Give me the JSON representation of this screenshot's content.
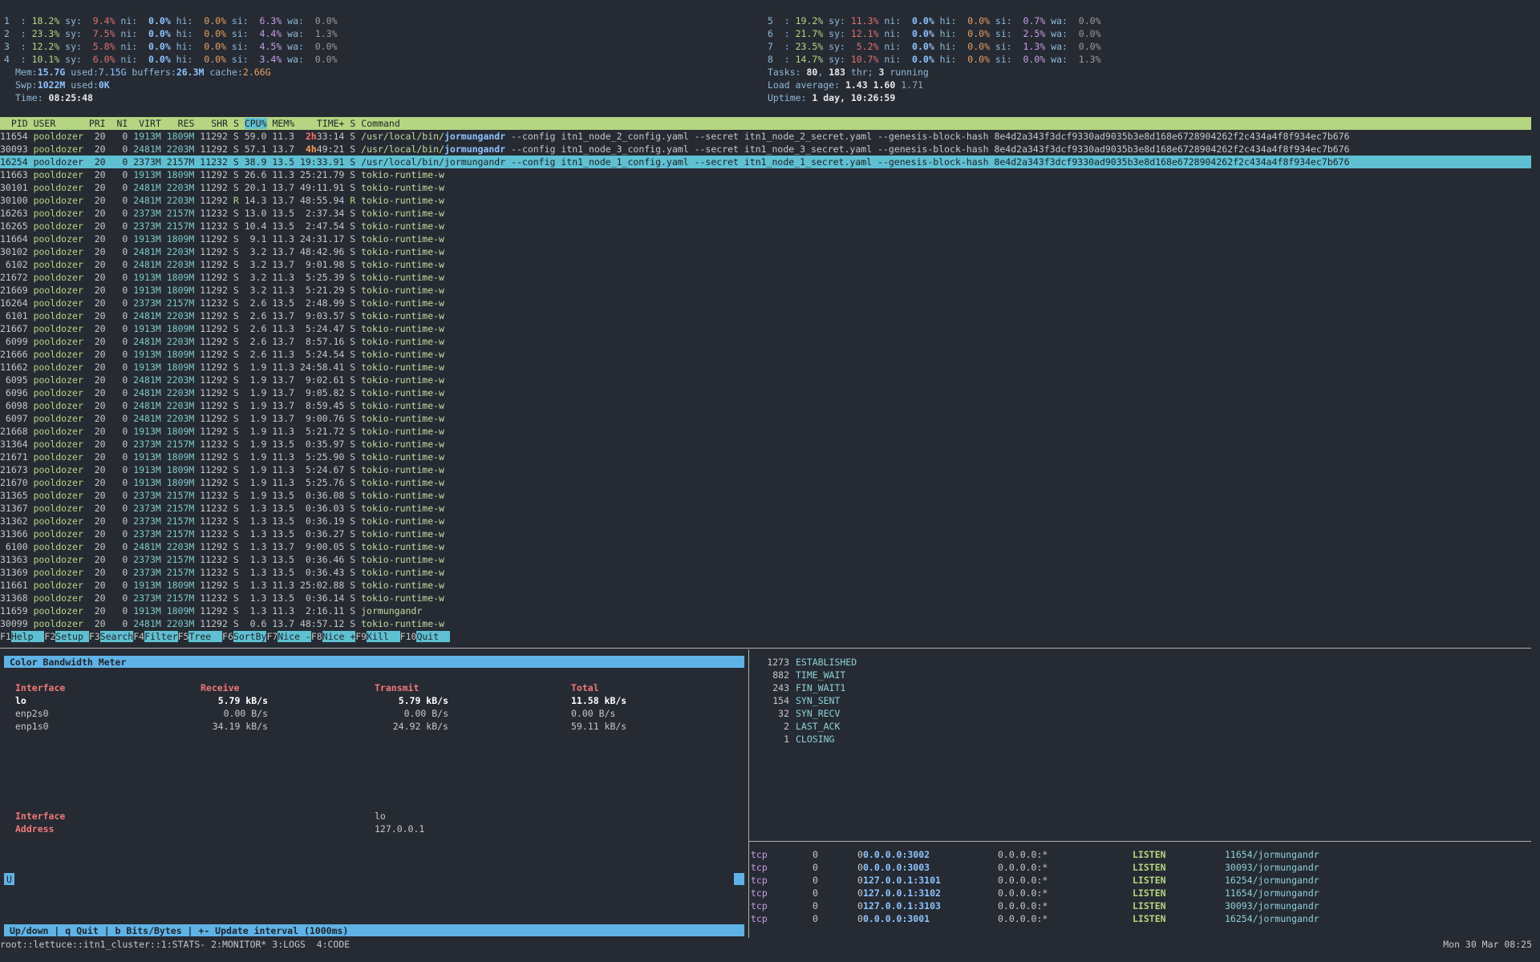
{
  "cpu_left": [
    {
      "n": "1",
      "us": "18.2%",
      "sy": "9.4%",
      "ni": "0.0%",
      "hi": "0.0%",
      "si": "6.3%",
      "wa": "0.0%"
    },
    {
      "n": "2",
      "us": "23.3%",
      "sy": "7.5%",
      "ni": "0.0%",
      "hi": "0.0%",
      "si": "4.4%",
      "wa": "1.3%"
    },
    {
      "n": "3",
      "us": "12.2%",
      "sy": "5.8%",
      "ni": "0.0%",
      "hi": "0.0%",
      "si": "4.5%",
      "wa": "0.0%"
    },
    {
      "n": "4",
      "us": "10.1%",
      "sy": "6.0%",
      "ni": "0.0%",
      "hi": "0.0%",
      "si": "3.4%",
      "wa": "0.0%"
    }
  ],
  "cpu_right": [
    {
      "n": "5",
      "us": "19.2%",
      "sy": "11.3%",
      "ni": "0.0%",
      "hi": "0.0%",
      "si": "0.7%",
      "wa": "0.0%"
    },
    {
      "n": "6",
      "us": "21.7%",
      "sy": "12.1%",
      "ni": "0.0%",
      "hi": "0.0%",
      "si": "2.5%",
      "wa": "0.0%"
    },
    {
      "n": "7",
      "us": "23.5%",
      "sy": "5.2%",
      "ni": "0.0%",
      "hi": "0.0%",
      "si": "1.3%",
      "wa": "0.0%"
    },
    {
      "n": "8",
      "us": "14.7%",
      "sy": "10.7%",
      "ni": "0.0%",
      "hi": "0.0%",
      "si": "0.0%",
      "wa": "1.3%"
    }
  ],
  "mem": {
    "total": "15.7G",
    "used": "7.15G",
    "buffers": "26.3M",
    "cache": "2.66G"
  },
  "swp": {
    "total": "1022M",
    "used": "0K"
  },
  "time": "08:25:48",
  "tasks": {
    "tasks": "80",
    "thr": "183",
    "running": "3"
  },
  "load": {
    "l1": "1.43",
    "l5": "1.60",
    "l15": "1.71"
  },
  "uptime": "1 day, 10:26:59",
  "proc_header": [
    "PID",
    "USER",
    "PRI",
    "NI",
    "VIRT",
    "RES",
    "SHR",
    "S",
    "CPU%",
    "MEM%",
    "TIME+",
    "S",
    "Command"
  ],
  "processes": [
    {
      "pid": "11654",
      "user": "pooldozer",
      "pri": "20",
      "ni": "0",
      "virt": "1913M",
      "res": "1809M",
      "shr": "11292",
      "s": "S",
      "cpu": "59.0",
      "mem": "11.3",
      "time_hi": "2h",
      "time": "33:14",
      "s2": "S",
      "cmd_pre": "/usr/local/bin/",
      "cmd_bold": "jormungandr",
      "cmd_post": " --config itn1_node_2_config.yaml --secret itn1_node_2_secret.yaml --genesis-block-hash 8e4d2a343f3dcf9330ad9035b3e8d168e6728904262f2c434a4f8f934ec7b676",
      "time_class": "timehi"
    },
    {
      "pid": "30093",
      "user": "pooldozer",
      "pri": "20",
      "ni": "0",
      "virt": "2481M",
      "res": "2203M",
      "shr": "11292",
      "s": "S",
      "cpu": "57.1",
      "mem": "13.7",
      "time_hi": "4h",
      "time": "49:21",
      "s2": "S",
      "cmd_pre": "/usr/local/bin/",
      "cmd_bold": "jormungandr",
      "cmd_post": " --config itn1_node_3_config.yaml --secret itn1_node_3_secret.yaml --genesis-block-hash 8e4d2a343f3dcf9330ad9035b3e8d168e6728904262f2c434a4f8f934ec7b676",
      "time_class": "timehi2"
    },
    {
      "pid": "16254",
      "user": "pooldozer",
      "pri": "20",
      "ni": "0",
      "virt": "2373M",
      "res": "2157M",
      "shr": "11232",
      "s": "S",
      "cpu": "38.9",
      "mem": "13.5",
      "time_hi": "",
      "time": "19:33.91",
      "s2": "S",
      "cmd_pre": "/usr/local/bin/",
      "cmd_bold": "jormungandr",
      "cmd_post": " --config itn1_node_1_config.yaml --secret itn1_node_1_secret.yaml --genesis-block-hash 8e4d2a343f3dcf9330ad9035b3e8d168e6728904262f2c434a4f8f934ec7b676",
      "selected": true
    },
    {
      "pid": "11663",
      "user": "pooldozer",
      "pri": "20",
      "ni": "0",
      "virt": "1913M",
      "res": "1809M",
      "shr": "11292",
      "s": "S",
      "cpu": "26.6",
      "mem": "11.3",
      "time": "25:21.79",
      "s2": "S",
      "cmd": "tokio-runtime-w"
    },
    {
      "pid": "30101",
      "user": "pooldozer",
      "pri": "20",
      "ni": "0",
      "virt": "2481M",
      "res": "2203M",
      "shr": "11292",
      "s": "S",
      "cpu": "20.1",
      "mem": "13.7",
      "time": "49:11.91",
      "s2": "S",
      "cmd": "tokio-runtime-w"
    },
    {
      "pid": "30100",
      "user": "pooldozer",
      "pri": "20",
      "ni": "0",
      "virt": "2481M",
      "res": "2203M",
      "shr": "11292",
      "s": "R",
      "cpu": "14.3",
      "mem": "13.7",
      "time": "48:55.94",
      "s2": "R",
      "cmd": "tokio-runtime-w"
    },
    {
      "pid": "16263",
      "user": "pooldozer",
      "pri": "20",
      "ni": "0",
      "virt": "2373M",
      "res": "2157M",
      "shr": "11232",
      "s": "S",
      "cpu": "13.0",
      "mem": "13.5",
      "time": "2:37.34",
      "s2": "S",
      "cmd": "tokio-runtime-w"
    },
    {
      "pid": "16265",
      "user": "pooldozer",
      "pri": "20",
      "ni": "0",
      "virt": "2373M",
      "res": "2157M",
      "shr": "11232",
      "s": "S",
      "cpu": "10.4",
      "mem": "13.5",
      "time": "2:47.54",
      "s2": "S",
      "cmd": "tokio-runtime-w"
    },
    {
      "pid": "11664",
      "user": "pooldozer",
      "pri": "20",
      "ni": "0",
      "virt": "1913M",
      "res": "1809M",
      "shr": "11292",
      "s": "S",
      "cpu": "9.1",
      "mem": "11.3",
      "time": "24:31.17",
      "s2": "S",
      "cmd": "tokio-runtime-w"
    },
    {
      "pid": "30102",
      "user": "pooldozer",
      "pri": "20",
      "ni": "0",
      "virt": "2481M",
      "res": "2203M",
      "shr": "11292",
      "s": "S",
      "cpu": "3.2",
      "mem": "13.7",
      "time": "48:42.96",
      "s2": "S",
      "cmd": "tokio-runtime-w"
    },
    {
      "pid": "6102",
      "user": "pooldozer",
      "pri": "20",
      "ni": "0",
      "virt": "2481M",
      "res": "2203M",
      "shr": "11292",
      "s": "S",
      "cpu": "3.2",
      "mem": "13.7",
      "time": "9:01.98",
      "s2": "S",
      "cmd": "tokio-runtime-w"
    },
    {
      "pid": "21672",
      "user": "pooldozer",
      "pri": "20",
      "ni": "0",
      "virt": "1913M",
      "res": "1809M",
      "shr": "11292",
      "s": "S",
      "cpu": "3.2",
      "mem": "11.3",
      "time": "5:25.39",
      "s2": "S",
      "cmd": "tokio-runtime-w"
    },
    {
      "pid": "21669",
      "user": "pooldozer",
      "pri": "20",
      "ni": "0",
      "virt": "1913M",
      "res": "1809M",
      "shr": "11292",
      "s": "S",
      "cpu": "3.2",
      "mem": "11.3",
      "time": "5:21.29",
      "s2": "S",
      "cmd": "tokio-runtime-w"
    },
    {
      "pid": "16264",
      "user": "pooldozer",
      "pri": "20",
      "ni": "0",
      "virt": "2373M",
      "res": "2157M",
      "shr": "11232",
      "s": "S",
      "cpu": "2.6",
      "mem": "13.5",
      "time": "2:48.99",
      "s2": "S",
      "cmd": "tokio-runtime-w"
    },
    {
      "pid": "6101",
      "user": "pooldozer",
      "pri": "20",
      "ni": "0",
      "virt": "2481M",
      "res": "2203M",
      "shr": "11292",
      "s": "S",
      "cpu": "2.6",
      "mem": "13.7",
      "time": "9:03.57",
      "s2": "S",
      "cmd": "tokio-runtime-w"
    },
    {
      "pid": "21667",
      "user": "pooldozer",
      "pri": "20",
      "ni": "0",
      "virt": "1913M",
      "res": "1809M",
      "shr": "11292",
      "s": "S",
      "cpu": "2.6",
      "mem": "11.3",
      "time": "5:24.47",
      "s2": "S",
      "cmd": "tokio-runtime-w"
    },
    {
      "pid": "6099",
      "user": "pooldozer",
      "pri": "20",
      "ni": "0",
      "virt": "2481M",
      "res": "2203M",
      "shr": "11292",
      "s": "S",
      "cpu": "2.6",
      "mem": "13.7",
      "time": "8:57.16",
      "s2": "S",
      "cmd": "tokio-runtime-w"
    },
    {
      "pid": "21666",
      "user": "pooldozer",
      "pri": "20",
      "ni": "0",
      "virt": "1913M",
      "res": "1809M",
      "shr": "11292",
      "s": "S",
      "cpu": "2.6",
      "mem": "11.3",
      "time": "5:24.54",
      "s2": "S",
      "cmd": "tokio-runtime-w"
    },
    {
      "pid": "11662",
      "user": "pooldozer",
      "pri": "20",
      "ni": "0",
      "virt": "1913M",
      "res": "1809M",
      "shr": "11292",
      "s": "S",
      "cpu": "1.9",
      "mem": "11.3",
      "time": "24:58.41",
      "s2": "S",
      "cmd": "tokio-runtime-w"
    },
    {
      "pid": "6095",
      "user": "pooldozer",
      "pri": "20",
      "ni": "0",
      "virt": "2481M",
      "res": "2203M",
      "shr": "11292",
      "s": "S",
      "cpu": "1.9",
      "mem": "13.7",
      "time": "9:02.61",
      "s2": "S",
      "cmd": "tokio-runtime-w"
    },
    {
      "pid": "6096",
      "user": "pooldozer",
      "pri": "20",
      "ni": "0",
      "virt": "2481M",
      "res": "2203M",
      "shr": "11292",
      "s": "S",
      "cpu": "1.9",
      "mem": "13.7",
      "time": "9:05.82",
      "s2": "S",
      "cmd": "tokio-runtime-w"
    },
    {
      "pid": "6098",
      "user": "pooldozer",
      "pri": "20",
      "ni": "0",
      "virt": "2481M",
      "res": "2203M",
      "shr": "11292",
      "s": "S",
      "cpu": "1.9",
      "mem": "13.7",
      "time": "8:59.45",
      "s2": "S",
      "cmd": "tokio-runtime-w"
    },
    {
      "pid": "6097",
      "user": "pooldozer",
      "pri": "20",
      "ni": "0",
      "virt": "2481M",
      "res": "2203M",
      "shr": "11292",
      "s": "S",
      "cpu": "1.9",
      "mem": "13.7",
      "time": "9:00.76",
      "s2": "S",
      "cmd": "tokio-runtime-w"
    },
    {
      "pid": "21668",
      "user": "pooldozer",
      "pri": "20",
      "ni": "0",
      "virt": "1913M",
      "res": "1809M",
      "shr": "11292",
      "s": "S",
      "cpu": "1.9",
      "mem": "11.3",
      "time": "5:21.72",
      "s2": "S",
      "cmd": "tokio-runtime-w"
    },
    {
      "pid": "31364",
      "user": "pooldozer",
      "pri": "20",
      "ni": "0",
      "virt": "2373M",
      "res": "2157M",
      "shr": "11232",
      "s": "S",
      "cpu": "1.9",
      "mem": "13.5",
      "time": "0:35.97",
      "s2": "S",
      "cmd": "tokio-runtime-w"
    },
    {
      "pid": "21671",
      "user": "pooldozer",
      "pri": "20",
      "ni": "0",
      "virt": "1913M",
      "res": "1809M",
      "shr": "11292",
      "s": "S",
      "cpu": "1.9",
      "mem": "11.3",
      "time": "5:25.90",
      "s2": "S",
      "cmd": "tokio-runtime-w"
    },
    {
      "pid": "21673",
      "user": "pooldozer",
      "pri": "20",
      "ni": "0",
      "virt": "1913M",
      "res": "1809M",
      "shr": "11292",
      "s": "S",
      "cpu": "1.9",
      "mem": "11.3",
      "time": "5:24.67",
      "s2": "S",
      "cmd": "tokio-runtime-w"
    },
    {
      "pid": "21670",
      "user": "pooldozer",
      "pri": "20",
      "ni": "0",
      "virt": "1913M",
      "res": "1809M",
      "shr": "11292",
      "s": "S",
      "cpu": "1.9",
      "mem": "11.3",
      "time": "5:25.76",
      "s2": "S",
      "cmd": "tokio-runtime-w"
    },
    {
      "pid": "31365",
      "user": "pooldozer",
      "pri": "20",
      "ni": "0",
      "virt": "2373M",
      "res": "2157M",
      "shr": "11232",
      "s": "S",
      "cpu": "1.9",
      "mem": "13.5",
      "time": "0:36.08",
      "s2": "S",
      "cmd": "tokio-runtime-w"
    },
    {
      "pid": "31367",
      "user": "pooldozer",
      "pri": "20",
      "ni": "0",
      "virt": "2373M",
      "res": "2157M",
      "shr": "11232",
      "s": "S",
      "cpu": "1.3",
      "mem": "13.5",
      "time": "0:36.03",
      "s2": "S",
      "cmd": "tokio-runtime-w"
    },
    {
      "pid": "31362",
      "user": "pooldozer",
      "pri": "20",
      "ni": "0",
      "virt": "2373M",
      "res": "2157M",
      "shr": "11232",
      "s": "S",
      "cpu": "1.3",
      "mem": "13.5",
      "time": "0:36.19",
      "s2": "S",
      "cmd": "tokio-runtime-w"
    },
    {
      "pid": "31366",
      "user": "pooldozer",
      "pri": "20",
      "ni": "0",
      "virt": "2373M",
      "res": "2157M",
      "shr": "11232",
      "s": "S",
      "cpu": "1.3",
      "mem": "13.5",
      "time": "0:36.27",
      "s2": "S",
      "cmd": "tokio-runtime-w"
    },
    {
      "pid": "6100",
      "user": "pooldozer",
      "pri": "20",
      "ni": "0",
      "virt": "2481M",
      "res": "2203M",
      "shr": "11292",
      "s": "S",
      "cpu": "1.3",
      "mem": "13.7",
      "time": "9:00.05",
      "s2": "S",
      "cmd": "tokio-runtime-w"
    },
    {
      "pid": "31363",
      "user": "pooldozer",
      "pri": "20",
      "ni": "0",
      "virt": "2373M",
      "res": "2157M",
      "shr": "11232",
      "s": "S",
      "cpu": "1.3",
      "mem": "13.5",
      "time": "0:36.46",
      "s2": "S",
      "cmd": "tokio-runtime-w"
    },
    {
      "pid": "31369",
      "user": "pooldozer",
      "pri": "20",
      "ni": "0",
      "virt": "2373M",
      "res": "2157M",
      "shr": "11232",
      "s": "S",
      "cpu": "1.3",
      "mem": "13.5",
      "time": "0:36.43",
      "s2": "S",
      "cmd": "tokio-runtime-w"
    },
    {
      "pid": "11661",
      "user": "pooldozer",
      "pri": "20",
      "ni": "0",
      "virt": "1913M",
      "res": "1809M",
      "shr": "11292",
      "s": "S",
      "cpu": "1.3",
      "mem": "11.3",
      "time": "25:02.88",
      "s2": "S",
      "cmd": "tokio-runtime-w"
    },
    {
      "pid": "31368",
      "user": "pooldozer",
      "pri": "20",
      "ni": "0",
      "virt": "2373M",
      "res": "2157M",
      "shr": "11232",
      "s": "S",
      "cpu": "1.3",
      "mem": "13.5",
      "time": "0:36.14",
      "s2": "S",
      "cmd": "tokio-runtime-w"
    },
    {
      "pid": "11659",
      "user": "pooldozer",
      "pri": "20",
      "ni": "0",
      "virt": "1913M",
      "res": "1809M",
      "shr": "11292",
      "s": "S",
      "cpu": "1.3",
      "mem": "11.3",
      "time": "2:16.11",
      "s2": "S",
      "cmd": "jormungandr"
    },
    {
      "pid": "30099",
      "user": "pooldozer",
      "pri": "20",
      "ni": "0",
      "virt": "2481M",
      "res": "2203M",
      "shr": "11292",
      "s": "S",
      "cpu": "0.6",
      "mem": "13.7",
      "time": "48:57.12",
      "s2": "S",
      "cmd": "tokio-runtime-w"
    }
  ],
  "fkeys": [
    {
      "k": "F1",
      "l": "Help  "
    },
    {
      "k": "F2",
      "l": "Setup "
    },
    {
      "k": "F3",
      "l": "Search"
    },
    {
      "k": "F4",
      "l": "Filter"
    },
    {
      "k": "F5",
      "l": "Tree  "
    },
    {
      "k": "F6",
      "l": "SortBy"
    },
    {
      "k": "F7",
      "l": "Nice -"
    },
    {
      "k": "F8",
      "l": "Nice +"
    },
    {
      "k": "F9",
      "l": "Kill  "
    },
    {
      "k": "F10",
      "l": "Quit  "
    }
  ],
  "bandwidth": {
    "title": "Color Bandwidth Meter",
    "headers": {
      "iface": "Interface",
      "rx": "Receive",
      "tx": "Transmit",
      "total": "Total"
    },
    "rows": [
      {
        "iface": "lo",
        "rx": "5.79 kB/s",
        "tx": "5.79 kB/s",
        "total": "11.58 kB/s",
        "bold": true
      },
      {
        "iface": "enp2s0",
        "rx": "0.00 B/s",
        "tx": "0.00 B/s",
        "total": "0.00 B/s"
      },
      {
        "iface": "enp1s0",
        "rx": "34.19 kB/s",
        "tx": "24.92 kB/s",
        "total": "59.11 kB/s"
      }
    ],
    "detail_iface_label": "Interface",
    "detail_iface": "lo",
    "detail_addr_label": "Address",
    "detail_addr": "127.0.0.1",
    "u_key": "U",
    "help": "Up/down | q Quit | b Bits/Bytes | +- Update interval (1000ms)"
  },
  "conn_states": [
    {
      "n": "1273",
      "s": "ESTABLISHED"
    },
    {
      "n": "882",
      "s": "TIME_WAIT"
    },
    {
      "n": "243",
      "s": "FIN_WAIT1"
    },
    {
      "n": "154",
      "s": "SYN_SENT"
    },
    {
      "n": "32",
      "s": "SYN_RECV"
    },
    {
      "n": "2",
      "s": "LAST_ACK"
    },
    {
      "n": "1",
      "s": "CLOSING"
    }
  ],
  "listen": [
    {
      "p": "tcp",
      "rq": "0",
      "sq": "0",
      "local": "0.0.0.0:3002",
      "foreign": "0.0.0.0:*",
      "state": "LISTEN",
      "prog": "11654/jormungandr"
    },
    {
      "p": "tcp",
      "rq": "0",
      "sq": "0",
      "local": "0.0.0.0:3003",
      "foreign": "0.0.0.0:*",
      "state": "LISTEN",
      "prog": "30093/jormungandr"
    },
    {
      "p": "tcp",
      "rq": "0",
      "sq": "0",
      "local": "127.0.0.1:3101",
      "foreign": "0.0.0.0:*",
      "state": "LISTEN",
      "prog": "16254/jormungandr"
    },
    {
      "p": "tcp",
      "rq": "0",
      "sq": "0",
      "local": "127.0.0.1:3102",
      "foreign": "0.0.0.0:*",
      "state": "LISTEN",
      "prog": "11654/jormungandr"
    },
    {
      "p": "tcp",
      "rq": "0",
      "sq": "0",
      "local": "127.0.0.1:3103",
      "foreign": "0.0.0.0:*",
      "state": "LISTEN",
      "prog": "30093/jormungandr"
    },
    {
      "p": "tcp",
      "rq": "0",
      "sq": "0",
      "local": "0.0.0.0:3001",
      "foreign": "0.0.0.0:*",
      "state": "LISTEN",
      "prog": "16254/jormungandr"
    }
  ],
  "statusbar": {
    "session": "root::lettuce::itn1_cluster::",
    "windows": "1:STATS- 2:MONITOR* 3:LOGS  4:CODE",
    "clock": "Mon 30 Mar 08:25"
  }
}
